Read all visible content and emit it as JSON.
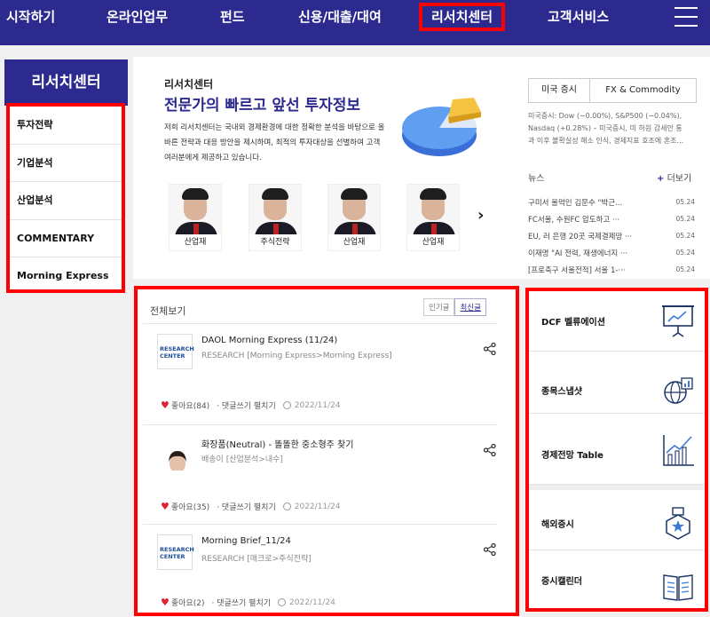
{
  "nav": {
    "items": [
      "시작하기",
      "온라인업무",
      "펀드",
      "신용/대출/대여",
      "리서치센터",
      "고객서비스"
    ],
    "active": "리서치센터"
  },
  "sidebar": {
    "title": "리서치센터",
    "items": [
      "투자전략",
      "기업분석",
      "산업분석",
      "COMMENTARY",
      "Morning Express"
    ]
  },
  "intro": {
    "subtitle": "리서치센터",
    "title": "전문가의 빠르고 앞선 투자정보",
    "desc": "저희 리서치센터는 국내외 경제환경에 대한 정확한 분석을 바탕으로 올바른 전략과 대응 방안을 제시하며, 최적의 투자대상을 선별하여 고객 여러분에게 제공하고 있습니다."
  },
  "analysts": [
    "산업재",
    "주식전략",
    "산업재",
    "산업재"
  ],
  "market": {
    "tabs": [
      "미국 증시",
      "FX & Commodity"
    ],
    "text": "미국증시: Dow (−0.00%), S&P500 (−0.04%), Nasdaq (+0.28%) – 미국증시, 미 하원 감세안 통과 이후 불확실성 해소 인식, 경제지표 호조에 혼조..."
  },
  "news": {
    "head": "뉴스",
    "more_label": "더보기",
    "items": [
      {
        "title": "구미서 울먹인 김문수 \"박근...",
        "date": "05.24"
      },
      {
        "title": "FC서울, 수원FC 압도하고 ···",
        "date": "05.24"
      },
      {
        "title": "EU, 러 은행 20곳 국제결제망 ···",
        "date": "05.24"
      },
      {
        "title": "이재명 \"AI 전력, 재생에너지 ···",
        "date": "05.24"
      },
      {
        "title": "[프로축구 서울전적] 서울 1-···",
        "date": "05.24"
      }
    ]
  },
  "feed": {
    "head": "전체보기",
    "sort": [
      "인기글",
      "최신글"
    ],
    "thumb_text": "RESEARCH CENTER",
    "posts": [
      {
        "title": "DAOL Morning Express (11/24)",
        "meta": "RESEARCH [Morning Express>Morning Express]",
        "likes": "좋아요(84)",
        "comment": "· 댓글쓰기 펼치기",
        "date": "2022/11/24"
      },
      {
        "title": "화장품(Neutral) - 똘똘한 중소형주 찾기",
        "meta": "배송이 [산업분석>내수]",
        "likes": "좋아요(35)",
        "comment": "· 댓글쓰기 펼치기",
        "date": "2022/11/24"
      },
      {
        "title": "Morning Brief_11/24",
        "meta": "RESEARCH [매크로>주식전략]",
        "likes": "좋아요(2)",
        "comment": "· 댓글쓰기 펼치기",
        "date": "2022/11/24"
      }
    ]
  },
  "tools": [
    "DCF 벨류에이션",
    "종목스냅샷",
    "경제전망 Table",
    "해외증시",
    "증시캘린더"
  ],
  "colors": {
    "brand": "#2d2a8f",
    "highlight": "#ff0000"
  }
}
